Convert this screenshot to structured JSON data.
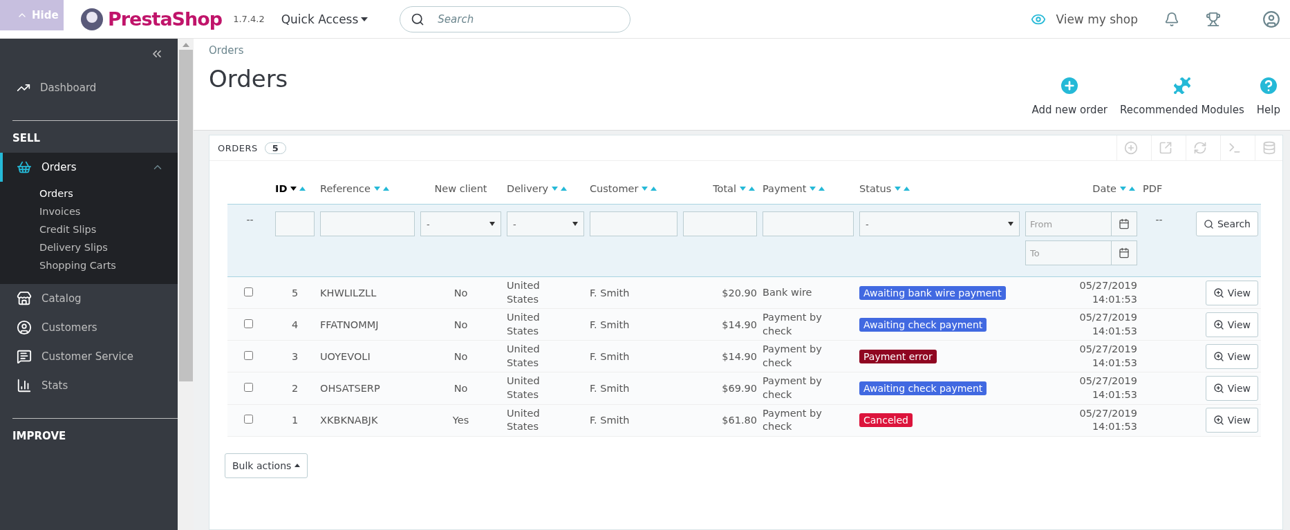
{
  "header": {
    "hide_button": "Hide",
    "logo": "PrestaShop",
    "version": "1.7.4.2",
    "quick_access": "Quick Access",
    "search": {
      "placeholder": "Search"
    },
    "view_shop": "View my shop"
  },
  "sidebar": {
    "dashboard": "Dashboard",
    "sections": [
      {
        "title": "SELL",
        "items": [
          {
            "label": "Orders",
            "selected": true,
            "expanded": true,
            "children": [
              {
                "label": "Orders",
                "selected": true
              },
              {
                "label": "Invoices",
                "selected": false
              },
              {
                "label": "Credit Slips",
                "selected": false
              },
              {
                "label": "Delivery Slips",
                "selected": false
              },
              {
                "label": "Shopping Carts",
                "selected": false
              }
            ]
          },
          {
            "label": "Catalog",
            "selected": false
          },
          {
            "label": "Customers",
            "selected": false
          },
          {
            "label": "Customer Service",
            "selected": false
          },
          {
            "label": "Stats",
            "selected": false
          }
        ]
      },
      {
        "title": "IMPROVE"
      }
    ]
  },
  "breadcrumb": "Orders",
  "title": "Orders",
  "toolbar": [
    "Add new order",
    "Recommended Modules",
    "Help"
  ],
  "panel": {
    "title": "ORDERS",
    "count": "5",
    "columns": [
      {
        "label": "ID",
        "sortable": true,
        "active": true
      },
      {
        "label": "Reference",
        "sortable": true,
        "active": false
      },
      {
        "label": "New client",
        "sortable": false,
        "active": false
      },
      {
        "label": "Delivery",
        "sortable": true,
        "active": false
      },
      {
        "label": "Customer",
        "sortable": true,
        "active": false
      },
      {
        "label": "Total",
        "sortable": true,
        "active": false
      },
      {
        "label": "Payment",
        "sortable": true,
        "active": false
      },
      {
        "label": "Status",
        "sortable": true,
        "active": false
      },
      {
        "label": "Date",
        "sortable": true,
        "active": false
      },
      {
        "label": "PDF",
        "sortable": false,
        "active": false
      }
    ],
    "filters": [
      {
        "kind": "none",
        "text": "--"
      },
      {
        "kind": "text"
      },
      {
        "kind": "text"
      },
      {
        "kind": "select",
        "value": "-"
      },
      {
        "kind": "select",
        "value": "-"
      },
      {
        "kind": "text"
      },
      {
        "kind": "text"
      },
      {
        "kind": "text"
      },
      {
        "kind": "select",
        "value": "-"
      },
      {
        "kind": "date",
        "fields": [
          {
            "placeholder": "From"
          },
          {
            "placeholder": "To"
          }
        ]
      },
      {
        "kind": "none",
        "text": "--"
      },
      {
        "kind": "button",
        "text": "Search"
      }
    ],
    "rows": [
      {
        "checked": false,
        "id": "5",
        "reference": "KHWLILZLL",
        "new_client": "No",
        "delivery": "United States",
        "customer": "F. Smith",
        "total": "$20.90",
        "payment": "Bank wire",
        "status": {
          "label": "Awaiting bank wire payment",
          "color": "#4169e1"
        },
        "date": "05/27/2019 14:01:53",
        "action": "View"
      },
      {
        "checked": false,
        "id": "4",
        "reference": "FFATNOMMJ",
        "new_client": "No",
        "delivery": "United States",
        "customer": "F. Smith",
        "total": "$14.90",
        "payment": "Payment by check",
        "status": {
          "label": "Awaiting check payment",
          "color": "#4169e1"
        },
        "date": "05/27/2019 14:01:53",
        "action": "View"
      },
      {
        "checked": false,
        "id": "3",
        "reference": "UOYEVOLI",
        "new_client": "No",
        "delivery": "United States",
        "customer": "F. Smith",
        "total": "$14.90",
        "payment": "Payment by check",
        "status": {
          "label": "Payment error",
          "color": "#8f0621"
        },
        "date": "05/27/2019 14:01:53",
        "action": "View"
      },
      {
        "checked": false,
        "id": "2",
        "reference": "OHSATSERP",
        "new_client": "No",
        "delivery": "United States",
        "customer": "F. Smith",
        "total": "$69.90",
        "payment": "Payment by check",
        "status": {
          "label": "Awaiting check payment",
          "color": "#4169e1"
        },
        "date": "05/27/2019 14:01:53",
        "action": "View"
      },
      {
        "checked": false,
        "id": "1",
        "reference": "XKBKNABJK",
        "new_client": "Yes",
        "delivery": "United States",
        "customer": "F. Smith",
        "total": "$61.80",
        "payment": "Payment by check",
        "status": {
          "label": "Canceled",
          "color": "#dc143c"
        },
        "date": "05/27/2019 14:01:53",
        "action": "View"
      }
    ],
    "bulk_actions": "Bulk actions"
  }
}
